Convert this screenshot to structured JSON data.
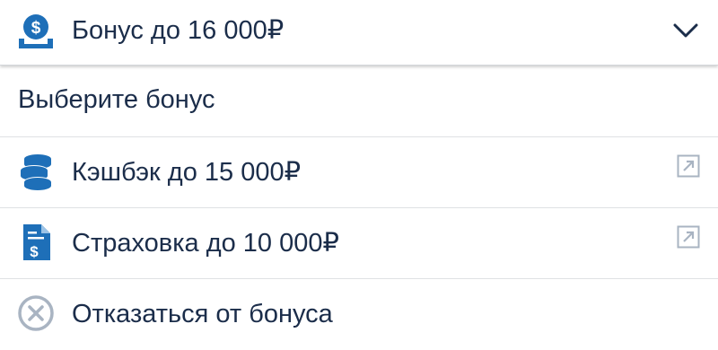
{
  "header": {
    "title": "Бонус до 16 000₽",
    "icon": "money-bag-icon",
    "chevron_icon": "chevron-down-icon"
  },
  "section_title": "Выберите бонус",
  "options": [
    {
      "label": "Кэшбэк до 15 000₽",
      "icon": "coins-stack-icon",
      "action_icon": "external-link-icon"
    },
    {
      "label": "Страховка до 10 000₽",
      "icon": "document-dollar-icon",
      "action_icon": "external-link-icon"
    },
    {
      "label": "Отказаться от бонуса",
      "icon": "cancel-circle-icon"
    }
  ],
  "colors": {
    "accent": "#1e6fb8",
    "text": "#1b2d4a",
    "muted_icon": "#a9b4c2",
    "divider": "#dfe1e4"
  }
}
